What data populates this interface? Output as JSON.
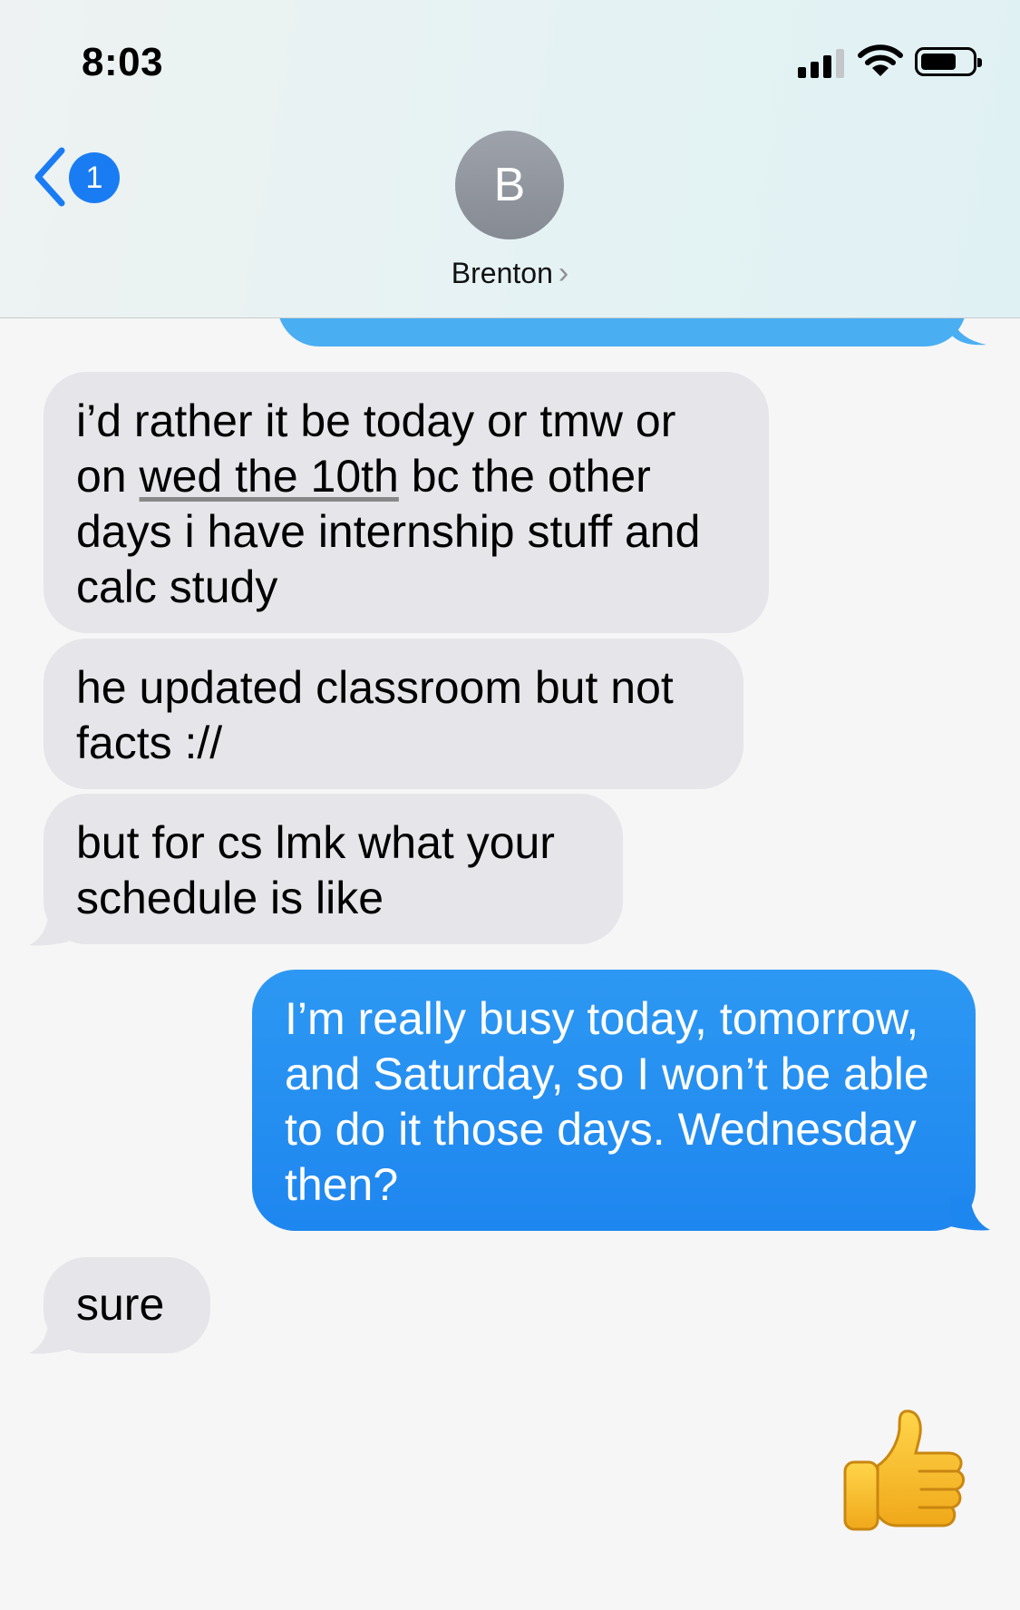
{
  "status_bar": {
    "time": "8:03"
  },
  "header": {
    "back_count": "1",
    "avatar_initial": "B",
    "contact_name": "Brenton",
    "contact_chevron": "›"
  },
  "messages": {
    "m1_a": "i’d rather it be today or tmw or on ",
    "m1_link": "wed the 10th",
    "m1_b": " bc the other days i have internship stuff and calc study",
    "m2": "he updated classroom but not facts ://",
    "m3": "but for cs lmk what your schedule is like",
    "m4": "I’m really busy today, tomorrow, and Saturday, so I won’t be able to do it those days. Wednesday then?",
    "m5": "sure"
  },
  "icons": {
    "signal": "cellular-signal-icon",
    "wifi": "wifi-icon",
    "battery": "battery-icon",
    "back": "chevron-left-icon",
    "reaction": "thumbs-up-emoji"
  },
  "colors": {
    "incoming": "#e5e5ea",
    "outgoing": "#1e86ef",
    "badge": "#1a7cf3"
  }
}
